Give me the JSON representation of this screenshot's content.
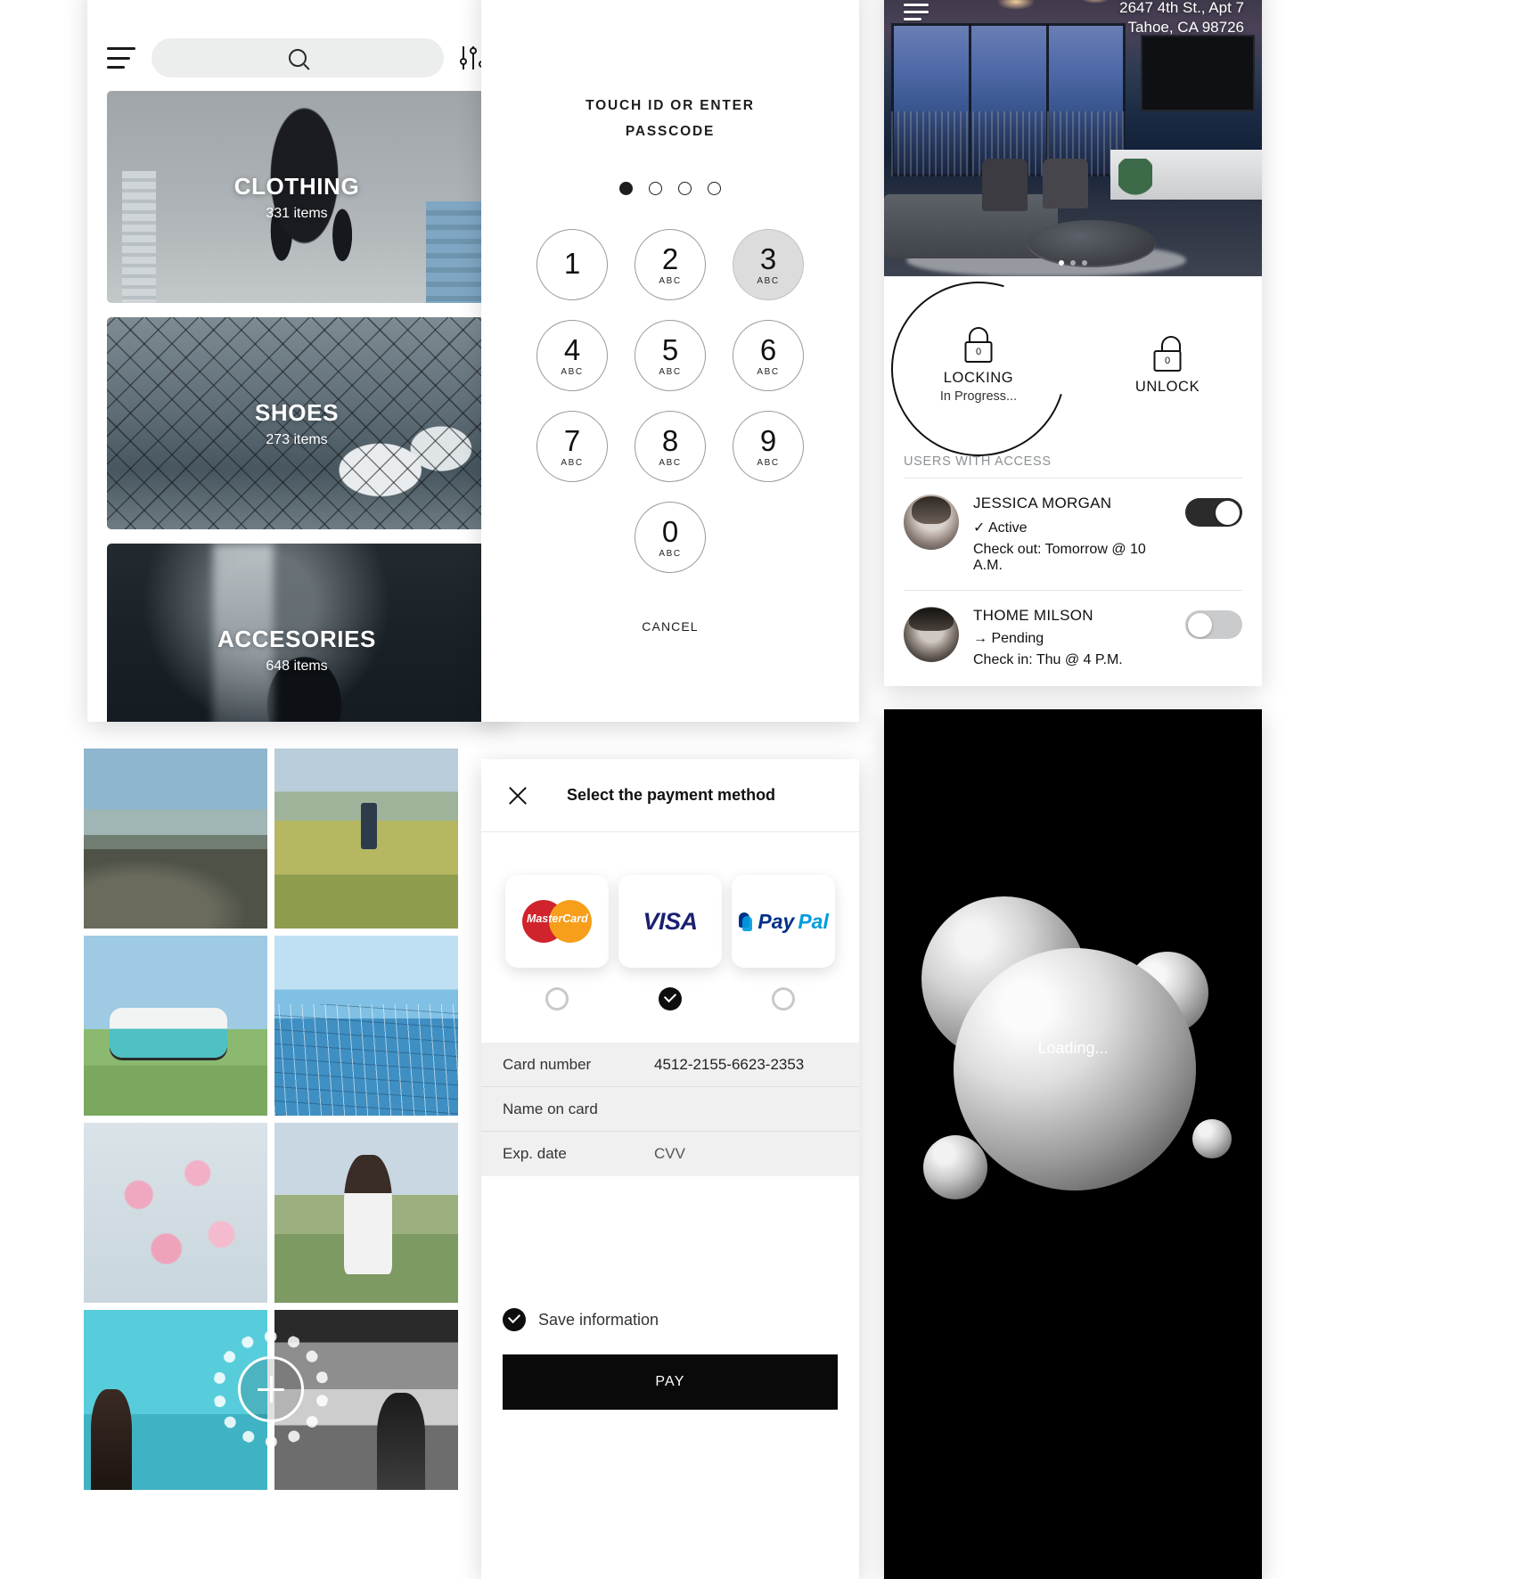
{
  "catalog": {
    "menu_icon": "hamburger-icon",
    "search": {
      "value": "",
      "placeholder": "",
      "icon": "search-icon"
    },
    "filter_icon": "sliders-icon",
    "categories": [
      {
        "title": "CLOTHING",
        "count": "331 items"
      },
      {
        "title": "SHOES",
        "count": "273 items"
      },
      {
        "title": "ACCESORIES",
        "count": "648 items"
      }
    ]
  },
  "passcode": {
    "title_line1": "TOUCH ID OR ENTER",
    "title_line2": "PASSCODE",
    "dots": [
      true,
      false,
      false,
      false
    ],
    "keys": [
      {
        "num": "1",
        "letters": ""
      },
      {
        "num": "2",
        "letters": "ABC"
      },
      {
        "num": "3",
        "letters": "ABC"
      },
      {
        "num": "4",
        "letters": "ABC"
      },
      {
        "num": "5",
        "letters": "ABC"
      },
      {
        "num": "6",
        "letters": "ABC"
      },
      {
        "num": "7",
        "letters": "ABC"
      },
      {
        "num": "8",
        "letters": "ABC"
      },
      {
        "num": "9",
        "letters": "ABC"
      },
      {
        "num": "0",
        "letters": "ABC"
      }
    ],
    "active_key": "3",
    "cancel_label": "CANCEL"
  },
  "smartlock": {
    "menu_icon": "hamburger-icon",
    "address_line1": "2647 4th St., Apt 7",
    "address_line2": "Tahoe, CA 98726",
    "carousel_dots": 3,
    "carousel_active": 0,
    "lock": {
      "icon": "lock-closed-icon",
      "label": "LOCKING",
      "sub": "In Progress..."
    },
    "unlock": {
      "icon": "lock-open-icon",
      "label": "UNLOCK",
      "sub": ""
    },
    "users_heading": "USERS WITH ACCESS",
    "users": [
      {
        "name": "JESSICA MORGAN",
        "status": "✓ Active",
        "check": "Check out: Tomorrow @ 10 A.M.",
        "toggle": "on"
      },
      {
        "name": "THOME MILSON",
        "status": "→ Pending",
        "check": "Check in: Thu @ 4 P.M.",
        "toggle": "off"
      }
    ]
  },
  "gallery": {
    "fab_icon": "plus-icon",
    "fab_label": "Add"
  },
  "payment": {
    "close_icon": "close-icon",
    "title": "Select the payment method",
    "methods": [
      {
        "id": "mastercard",
        "label": "MasterCard",
        "selected": false
      },
      {
        "id": "visa",
        "label": "VISA",
        "selected": true
      },
      {
        "id": "paypal",
        "label": "PayPal",
        "selected": false
      }
    ],
    "fields": [
      {
        "label": "Card number",
        "value": "4512-2155-6623-2353"
      },
      {
        "label": "Name on card",
        "value": ""
      },
      {
        "label": "Exp. date",
        "value": "CVV"
      }
    ],
    "save_label": "Save information",
    "save_checked": true,
    "pay_label": "PAY"
  },
  "loading": {
    "label": "Loading..."
  },
  "colors": {
    "accent": "#000000",
    "surface": "#ffffff",
    "field_bg": "#f0f0f0",
    "mastercard_red": "#d0232b",
    "mastercard_orange": "#f79e1b",
    "visa_blue": "#1a1f71",
    "paypal_dark": "#003087",
    "paypal_light": "#009cde",
    "toggle_on": "#2b2b2b",
    "toggle_off": "#c9cbcc"
  }
}
